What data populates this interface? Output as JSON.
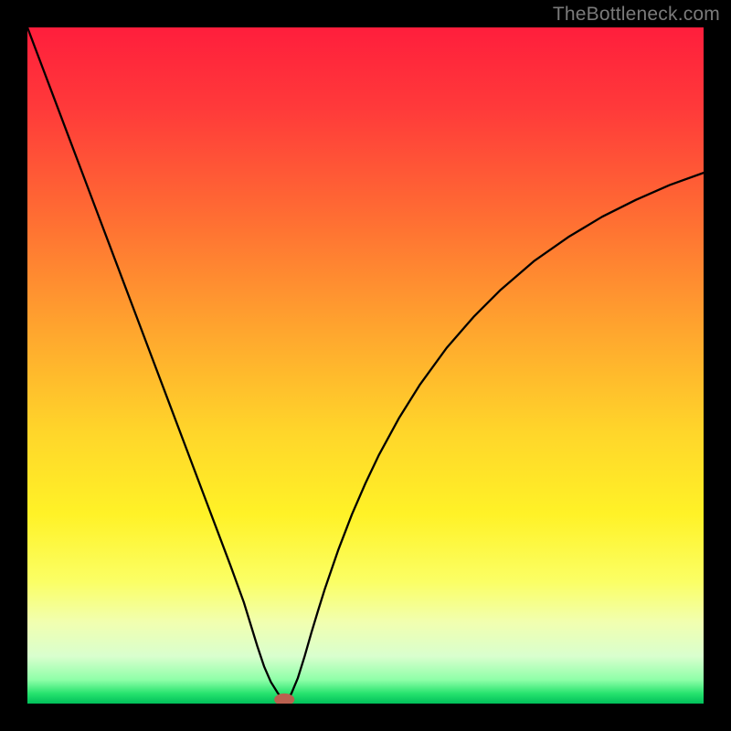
{
  "watermark": "TheBottleneck.com",
  "chart_data": {
    "type": "line",
    "title": "",
    "xlabel": "",
    "ylabel": "",
    "xlim": [
      0,
      100
    ],
    "ylim": [
      0,
      100
    ],
    "background_gradient": {
      "stops": [
        {
          "offset": 0.0,
          "color": "#ff1e3c"
        },
        {
          "offset": 0.12,
          "color": "#ff3a3a"
        },
        {
          "offset": 0.28,
          "color": "#ff6d33"
        },
        {
          "offset": 0.45,
          "color": "#ffa62e"
        },
        {
          "offset": 0.6,
          "color": "#ffd62a"
        },
        {
          "offset": 0.72,
          "color": "#fff227"
        },
        {
          "offset": 0.82,
          "color": "#fbff65"
        },
        {
          "offset": 0.88,
          "color": "#f1ffb0"
        },
        {
          "offset": 0.93,
          "color": "#d9ffce"
        },
        {
          "offset": 0.965,
          "color": "#8effa8"
        },
        {
          "offset": 0.985,
          "color": "#27e36e"
        },
        {
          "offset": 1.0,
          "color": "#00c05a"
        }
      ]
    },
    "series": [
      {
        "name": "bottleneck-curve",
        "color": "#000000",
        "stroke_width": 2.3,
        "x": [
          0,
          2,
          4,
          6,
          8,
          10,
          12,
          14,
          16,
          18,
          20,
          22,
          24,
          26,
          28,
          30,
          32,
          34,
          35,
          36,
          37,
          37.7,
          38.3,
          39,
          40,
          41,
          42,
          43,
          44,
          46,
          48,
          50,
          52,
          55,
          58,
          62,
          66,
          70,
          75,
          80,
          85,
          90,
          95,
          100
        ],
        "y": [
          100,
          94.7,
          89.4,
          84.1,
          78.8,
          73.5,
          68.2,
          62.9,
          57.6,
          52.3,
          47,
          41.7,
          36.4,
          31.1,
          25.8,
          20.5,
          15.0,
          8.5,
          5.5,
          3.2,
          1.6,
          0.7,
          0.6,
          1.4,
          3.8,
          7.0,
          10.5,
          13.8,
          17.0,
          22.8,
          28.0,
          32.6,
          36.8,
          42.3,
          47.1,
          52.6,
          57.2,
          61.2,
          65.5,
          69.0,
          72.0,
          74.5,
          76.7,
          78.5
        ]
      }
    ],
    "marker": {
      "cx": 38.0,
      "cy": 0.6,
      "rx": 1.5,
      "ry": 0.9,
      "fill": "#b9604f"
    }
  }
}
